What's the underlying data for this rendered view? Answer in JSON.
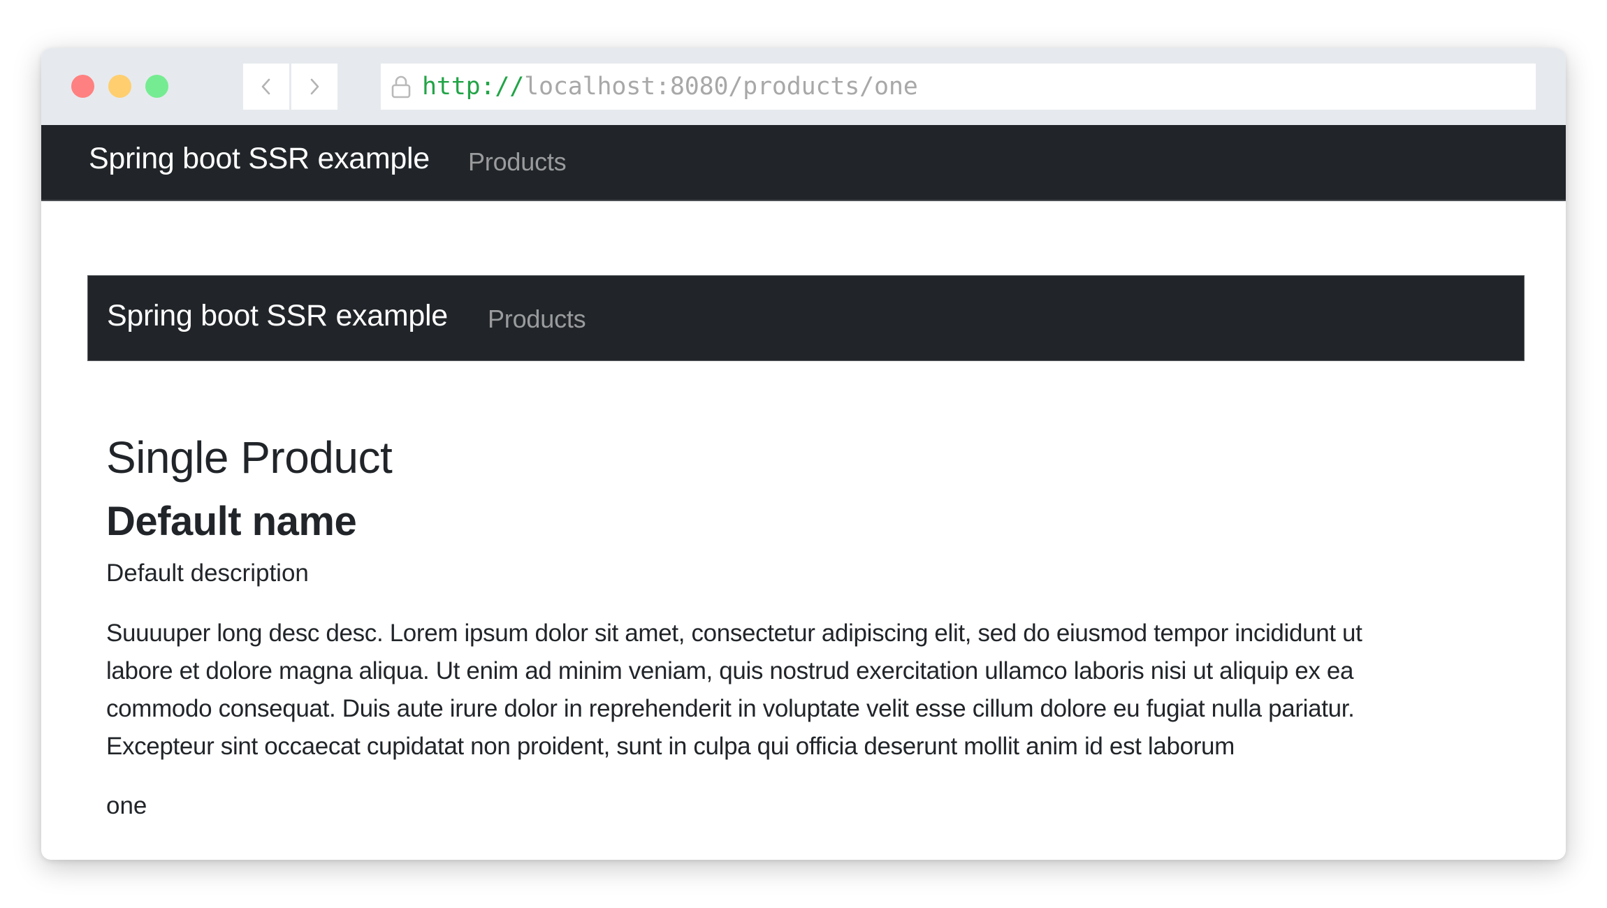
{
  "browser": {
    "window_controls": {
      "close_color": "#ff8080",
      "minimize_color": "#ffce6f",
      "maximize_color": "#75ec91"
    },
    "back_icon": "chevron-left-icon",
    "forward_icon": "chevron-right-icon",
    "lock_icon": "lock-icon",
    "url_scheme": "http://",
    "url_rest": "localhost:8080/products/one",
    "url_scheme_color": "#22a447"
  },
  "navbar": {
    "brand": "Spring boot SSR example",
    "links": [
      {
        "label": "Products"
      }
    ],
    "background": "#212529"
  },
  "inner_navbar": {
    "brand": "Spring boot SSR example",
    "links": [
      {
        "label": "Products"
      }
    ]
  },
  "main": {
    "title": "Single Product",
    "product": {
      "name": "Default name",
      "description": "Default description",
      "long_description_lines": [
        "Suuuuper long desc desc. Lorem ipsum dolor sit amet, consectetur adipiscing elit, sed do eiusmod tempor incididunt ut",
        "labore et dolore magna aliqua. Ut enim ad minim veniam, quis nostrud exercitation ullamco laboris nisi ut aliquip ex ea",
        "commodo consequat. Duis aute irure dolor in reprehenderit in voluptate velit esse cillum dolore eu fugiat nulla pariatur.",
        "Excepteur sint occaecat cupidatat non proident, sunt in culpa qui officia deserunt mollit anim id est laborum"
      ],
      "id": "one"
    }
  }
}
